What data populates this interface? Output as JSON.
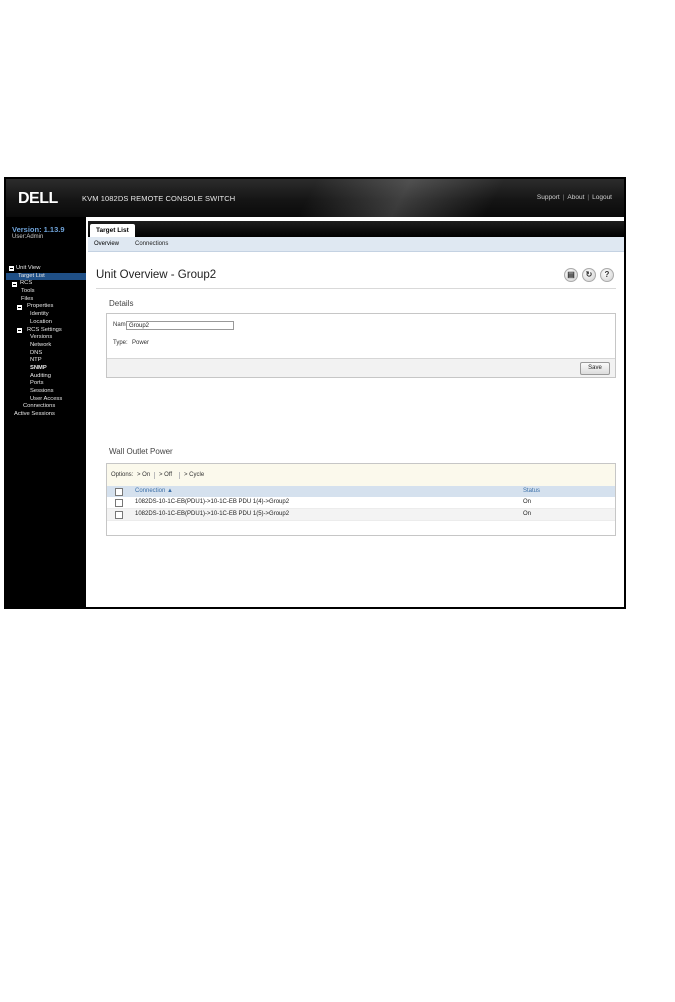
{
  "header": {
    "logo": "DELL",
    "product": "KVM 1082DS REMOTE CONSOLE SWITCH",
    "links": [
      "Support",
      "About",
      "Logout"
    ]
  },
  "sidebar": {
    "version": "Version: 1.13.9",
    "user": "User:Admin",
    "tree": [
      {
        "label": "Unit View",
        "toggle": true
      },
      {
        "label": "Target List",
        "selected": true
      },
      {
        "label": "RCS",
        "toggle": true
      },
      {
        "label": "Tools"
      },
      {
        "label": "Files"
      },
      {
        "label": "Properties",
        "toggle": true
      },
      {
        "label": "Identity"
      },
      {
        "label": "Location"
      },
      {
        "label": "RCS Settings",
        "toggle": true
      },
      {
        "label": "Versions"
      },
      {
        "label": "Network"
      },
      {
        "label": "DNS"
      },
      {
        "label": "NTP"
      },
      {
        "label": "SNMP"
      },
      {
        "label": "Auditing"
      },
      {
        "label": "Ports"
      },
      {
        "label": "Sessions"
      },
      {
        "label": "User Access"
      },
      {
        "label": "Connections"
      },
      {
        "label": "Active Sessions"
      }
    ]
  },
  "main": {
    "tab": "Target List",
    "subtabs": [
      "Overview",
      "Connections"
    ],
    "title": "Unit Overview - Group2",
    "icons": [
      "print-icon",
      "refresh-icon",
      "help-icon"
    ],
    "details": {
      "section": "Details",
      "name_label": "Name:",
      "name_value": "Group2",
      "type_label": "Type:",
      "type_value": "Power",
      "save": "Save"
    },
    "outlets": {
      "section": "Wall Outlet Power",
      "options_label": "Options:",
      "options": [
        "> On",
        "> Off",
        "> Cycle"
      ],
      "columns": [
        "Connection ▲",
        "Status"
      ],
      "rows": [
        {
          "connection": "1082DS-10-1C-EB(PDU1)->10-1C-EB PDU 1(4)->Group2",
          "status": "On"
        },
        {
          "connection": "1082DS-10-1C-EB(PDU1)->10-1C-EB PDU 1(5)->Group2",
          "status": "On"
        }
      ]
    }
  },
  "colors": {
    "header_bg": "#151515",
    "sidebar_bg": "#000000",
    "version_blue": "#6fa3d9",
    "selected_blue": "#1f4f86",
    "subtab_bg": "#dfe8f2",
    "table_header_bg": "#d5e1ee",
    "options_bg": "#fbf9ec"
  }
}
